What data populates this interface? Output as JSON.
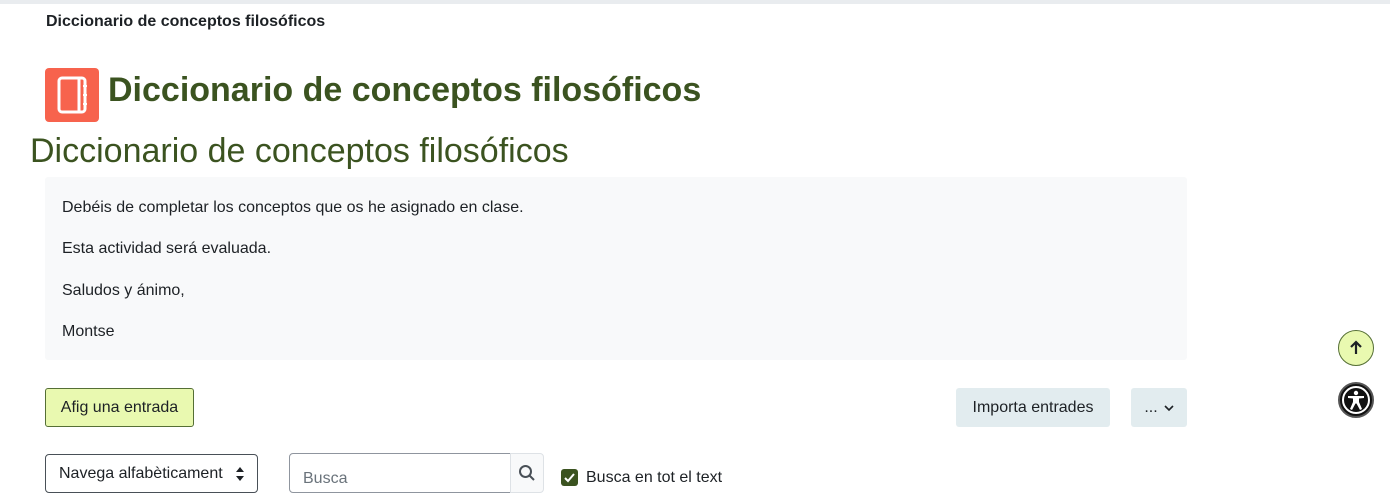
{
  "breadcrumb": {
    "current": "Diccionario de conceptos filosóficos"
  },
  "activity": {
    "icon": "glossary-book-icon",
    "icon_color": "#f7634d",
    "title": "Diccionario de conceptos filosóficos",
    "subtitle": "Diccionario de conceptos filosóficos"
  },
  "intro": {
    "paragraphs": [
      "Debéis de completar los conceptos que os he asignado en clase.",
      "Esta actividad será evaluada.",
      "Saludos y ánimo,",
      "Montse"
    ]
  },
  "actions": {
    "add_entry": "Afig una entrada",
    "import_entries": "Importa entrades",
    "more": "..."
  },
  "filters": {
    "browse_select": "Navega alfabèticament",
    "search_placeholder": "Busca",
    "fulltext_label": "Busca en tot el text",
    "fulltext_checked": true
  },
  "floating": {
    "back_to_top_icon": "arrow-up-icon",
    "accessibility_icon": "accessibility-icon"
  },
  "colors": {
    "heading": "#3b5320",
    "accent_bg": "#e9f9b0",
    "secondary_bg": "#e2ecef"
  }
}
